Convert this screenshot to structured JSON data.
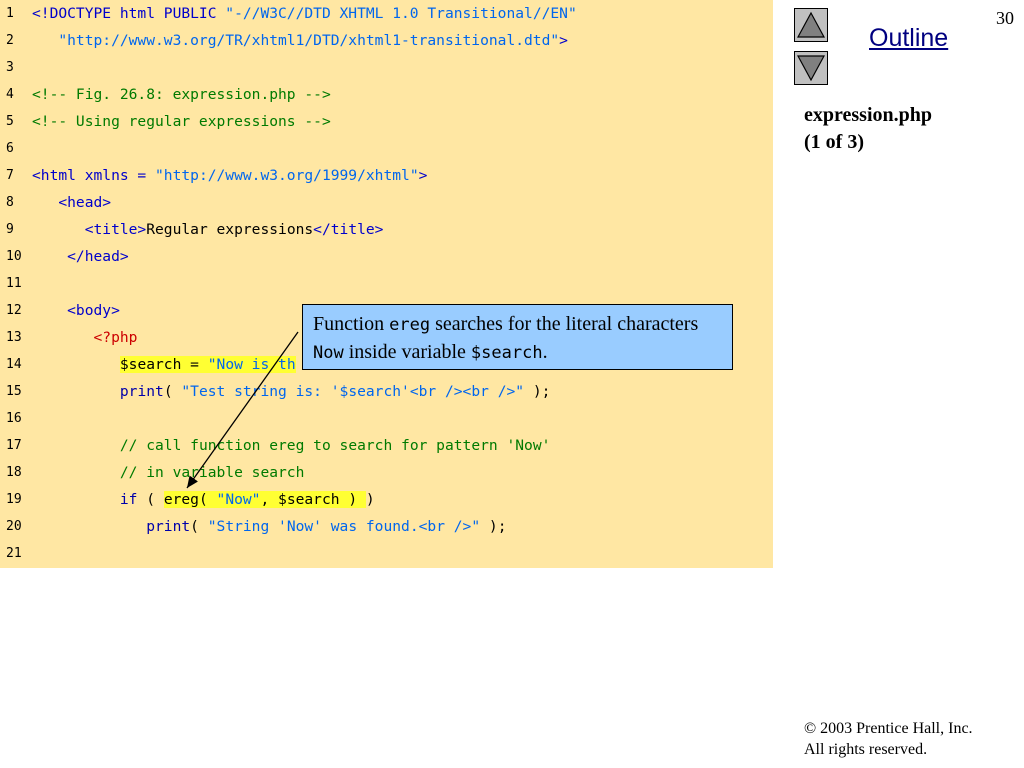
{
  "slide": {
    "number": "30"
  },
  "nav": {
    "outline_label": "Outline"
  },
  "file": {
    "name": "expression.php",
    "page": "(1 of 3)"
  },
  "code": {
    "line_numbers": [
      "1",
      "2",
      "3",
      "4",
      "5",
      "6",
      "7",
      "8",
      "9",
      "10",
      "11",
      "12",
      "13",
      "14",
      "15",
      "16",
      "17",
      "18",
      "19",
      "20",
      "21"
    ],
    "l1_a": "<!DOCTYPE html PUBLIC ",
    "l1_b": "\"-//W3C//DTD XHTML 1.0 Transitional//EN\"",
    "l2_a": "   \"http://www.w3.org/TR/xhtml1/DTD/xhtml1-transitional.dtd\"",
    "l2_b": ">",
    "l4": "<!-- Fig. 26.8: expression.php -->",
    "l5": "<!-- Using regular expressions -->",
    "l7_a": "<html xmlns = ",
    "l7_b": "\"http://www.w3.org/1999/xhtml\"",
    "l7_c": ">",
    "l8": "   <head>",
    "l9_a": "      <title>",
    "l9_b": "Regular expressions",
    "l9_c": "</title>",
    "l10": "    </head>",
    "l12": "    <body>",
    "l13": "       <?php",
    "l14_a": "$search = ",
    "l14_b": "\"Now is th",
    "l15_a": "print",
    "l15_b": "( ",
    "l15_c": "\"Test string is: '$search'<br /><br />\"",
    "l15_d": " );",
    "l17": "// call function ereg to search for pattern 'Now'",
    "l18": "// in variable search",
    "l19_a": "if",
    "l19_b": " ( ",
    "l19_c": "ereg( ",
    "l19_d": "\"Now\"",
    "l19_e": ", $search ) ",
    "l19_f": ")",
    "l20_a": "print",
    "l20_b": "( ",
    "l20_c": "\"String 'Now' was found.<br />\"",
    "l20_d": " );"
  },
  "callout": {
    "t1": "Function ",
    "c1": "ereg",
    "t2": " searches for the literal characters ",
    "c2": "Now",
    "t3": " inside variable ",
    "c3": "$search",
    "t4": "."
  },
  "footer": {
    "line1": "© 2003 Prentice Hall, Inc.",
    "line2": "All rights reserved."
  },
  "colors": {
    "code_bg": "#ffe7a3",
    "callout_bg": "#99ccff",
    "highlight": "#ffff33",
    "tag": "#0000cc",
    "string": "#0066ee",
    "comment": "#007a00"
  },
  "icons": {
    "up": "up-triangle-icon",
    "down": "down-triangle-icon"
  }
}
